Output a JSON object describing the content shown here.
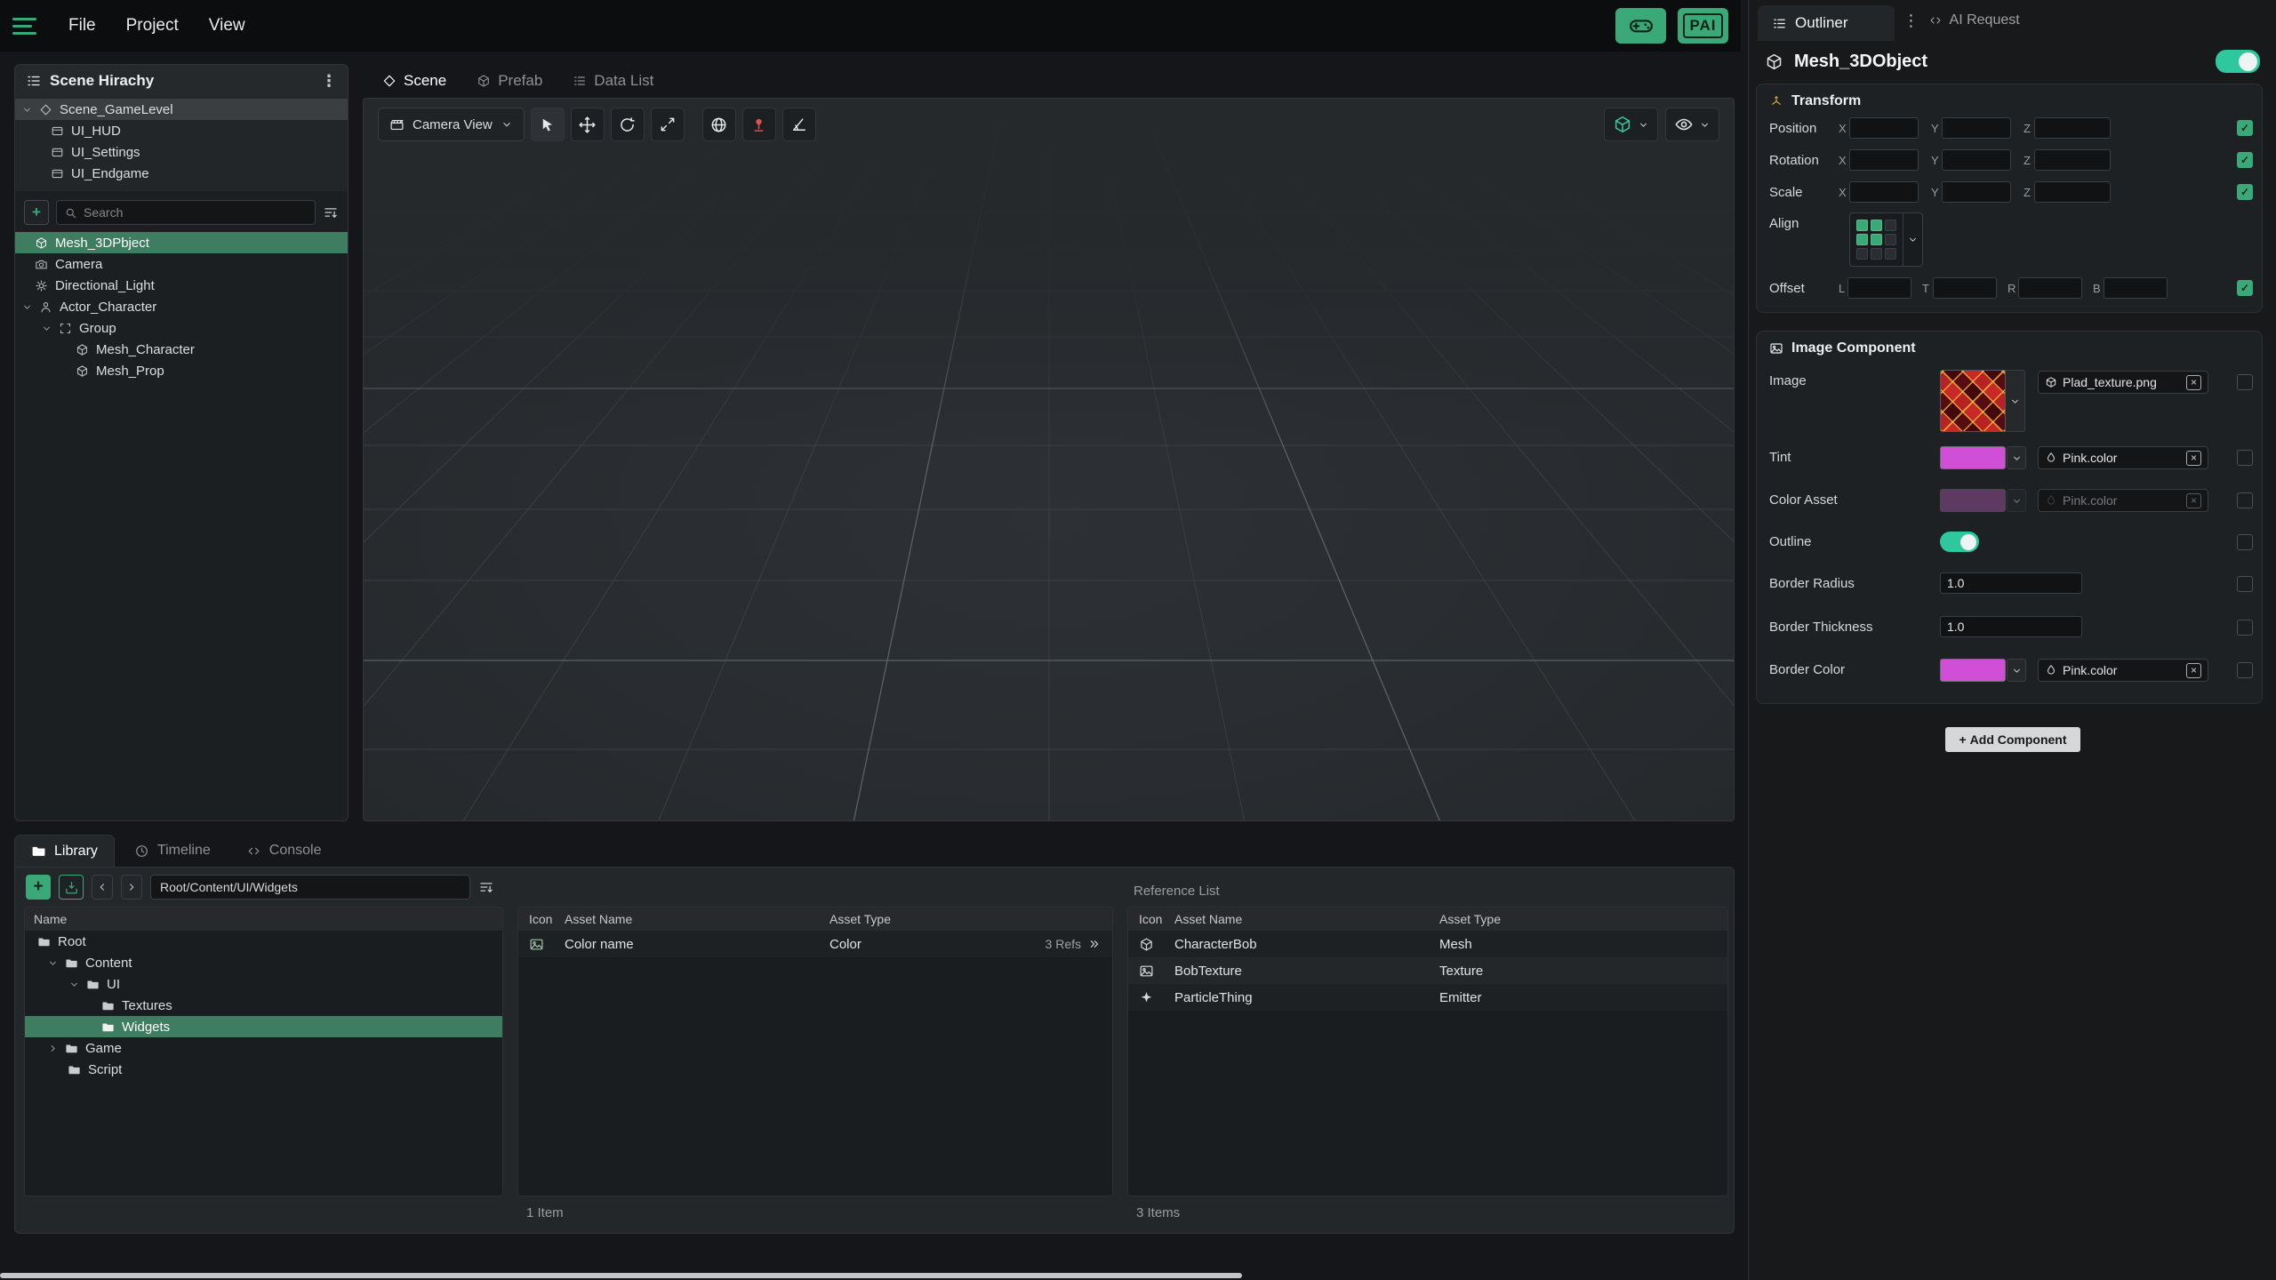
{
  "colors": {
    "accent_green": "#3BA877",
    "selection_green": "#3E7D5F",
    "toggle_teal": "#2FC79E",
    "swatch_pink": "#D14FD6",
    "swatch_pink_disabled": "#5E3A63",
    "texture_red": "#B02525"
  },
  "menubar": {
    "menus": [
      {
        "label": "File"
      },
      {
        "label": "Project"
      },
      {
        "label": "View"
      }
    ],
    "pai_label": "PAI"
  },
  "hierarchy": {
    "title": "Scene Hirachy",
    "levels": [
      {
        "label": "Scene_GameLevel"
      },
      {
        "label": "UI_HUD"
      },
      {
        "label": "UI_Settings"
      },
      {
        "label": "UI_Endgame"
      }
    ],
    "search_placeholder": "Search",
    "objects": [
      {
        "label": "Mesh_3DPbject"
      },
      {
        "label": "Camera"
      },
      {
        "label": "Directional_Light"
      },
      {
        "label": "Actor_Character"
      },
      {
        "label": "Group"
      },
      {
        "label": "Mesh_Character"
      },
      {
        "label": "Mesh_Prop"
      }
    ]
  },
  "viewport": {
    "tabs": [
      {
        "label": "Scene"
      },
      {
        "label": "Prefab"
      },
      {
        "label": "Data List"
      }
    ],
    "camera_view": "Camera View"
  },
  "outliner": {
    "tab": "Outliner",
    "ai_request": "AI Request",
    "object_name": "Mesh_3DObject",
    "transform": {
      "title": "Transform",
      "position_label": "Position",
      "rotation_label": "Rotation",
      "scale_label": "Scale",
      "axis_x": "X",
      "axis_y": "Y",
      "axis_z": "Z",
      "align_label": "Align",
      "offset_label": "Offset",
      "offset_l": "L",
      "offset_t": "T",
      "offset_r": "R",
      "offset_b": "B"
    },
    "image_component": {
      "title": "Image Component",
      "image_label": "Image",
      "image_asset": "Plad_texture.png",
      "tint_label": "Tint",
      "tint_asset": "Pink.color",
      "color_asset_label": "Color Asset",
      "color_asset_value": "Pink.color",
      "outline_label": "Outline",
      "border_radius_label": "Border Radius",
      "border_radius_value": "1.0",
      "border_thickness_label": "Border Thickness",
      "border_thickness_value": "1.0",
      "border_color_label": "Border Color",
      "border_color_asset": "Pink.color"
    },
    "add_component": "Add Component",
    "add_component_plus": "+"
  },
  "library": {
    "tabs": [
      {
        "label": "Library"
      },
      {
        "label": "Timeline"
      },
      {
        "label": "Console"
      }
    ],
    "path": "Root/Content/UI/Widgets",
    "tree_header": "Name",
    "folders": [
      {
        "label": "Root"
      },
      {
        "label": "Content"
      },
      {
        "label": "UI"
      },
      {
        "label": "Textures"
      },
      {
        "label": "Widgets"
      },
      {
        "label": "Game"
      },
      {
        "label": "Script"
      }
    ],
    "asset_table": {
      "headers": {
        "icon": "Icon",
        "name": "Asset Name",
        "type": "Asset Type"
      },
      "rows": [
        {
          "name": "Color name",
          "type": "Color",
          "refs": "3 Refs"
        }
      ],
      "footer": "1 Item"
    },
    "reference_list": {
      "title": "Reference List",
      "headers": {
        "icon": "Icon",
        "name": "Asset Name",
        "type": "Asset Type"
      },
      "rows": [
        {
          "name": "CharacterBob",
          "type": "Mesh"
        },
        {
          "name": "BobTexture",
          "type": "Texture"
        },
        {
          "name": "ParticleThing",
          "type": "Emitter"
        }
      ],
      "footer": "3 Items"
    }
  }
}
